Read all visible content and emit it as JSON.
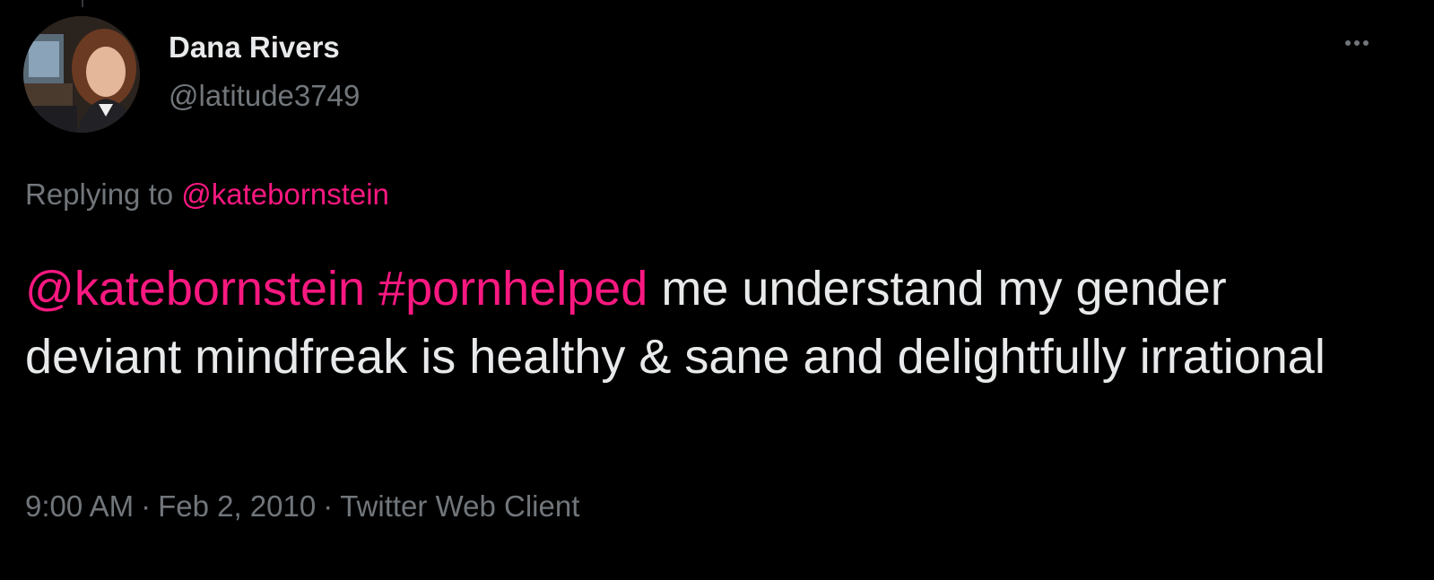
{
  "author": {
    "display_name": "Dana Rivers",
    "handle": "@latitude3749"
  },
  "reply_context": {
    "prefix": "Replying to",
    "mention": "@katebornstein"
  },
  "tweet": {
    "mention": "@katebornstein",
    "hashtag": "#pornhelped",
    "body": "me understand my gender deviant mindfreak is healthy & sane and delightfully irrational"
  },
  "meta": {
    "time": "9:00 AM",
    "separator": "·",
    "date": "Feb 2, 2010",
    "source": "Twitter Web Client"
  },
  "icons": {
    "more": "more-horizontal-icon"
  },
  "colors": {
    "background": "#000000",
    "text": "#e7e9ea",
    "secondary": "#71767b",
    "accent": "#f91880"
  }
}
